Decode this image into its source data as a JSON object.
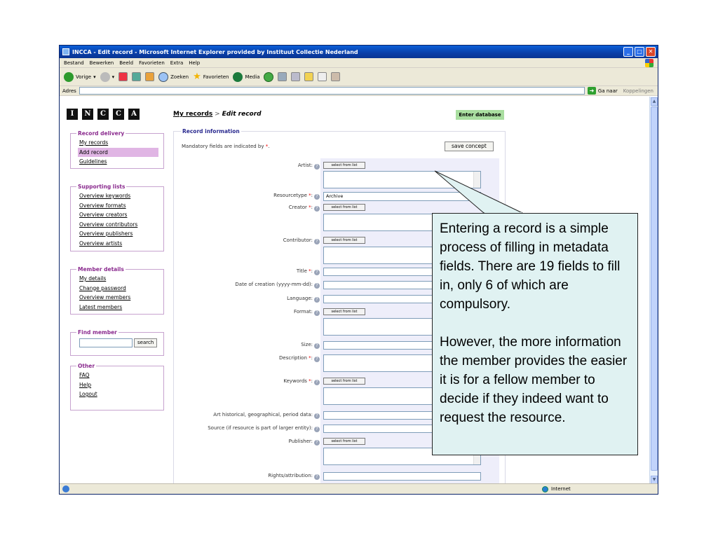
{
  "window": {
    "title": "INCCA - Edit record - Microsoft Internet Explorer provided by Instituut Collectie Nederland"
  },
  "menu": [
    "Bestand",
    "Bewerken",
    "Beeld",
    "Favorieten",
    "Extra",
    "Help"
  ],
  "toolbar": {
    "back": "Vorige",
    "search": "Zoeken",
    "favorites": "Favorieten",
    "media": "Media"
  },
  "address": {
    "label": "Adres",
    "go": "Ga naar",
    "links": "Koppelingen"
  },
  "logo_letters": [
    "I",
    "N",
    "C",
    "C",
    "A"
  ],
  "breadcrumb": {
    "link": "My records",
    "sep": ">",
    "current": "Edit record"
  },
  "enter_database": "Enter database",
  "sidebar": {
    "record_delivery": {
      "legend": "Record delivery",
      "items": [
        "My records",
        "Add record",
        "Guidelines"
      ]
    },
    "supporting_lists": {
      "legend": "Supporting lists",
      "items": [
        "Overview keywords",
        "Overview formats",
        "Overview creators",
        "Overview contributors",
        "Overview publishers",
        "Overview artists"
      ]
    },
    "member_details": {
      "legend": "Member details",
      "items": [
        "My details",
        "Change password",
        "Overview members",
        "Latest members"
      ]
    },
    "find_member": {
      "legend": "Find member",
      "button": "search"
    },
    "other": {
      "legend": "Other",
      "items": [
        "FAQ",
        "Help",
        "Logout"
      ]
    }
  },
  "record": {
    "legend": "Record information",
    "mandatory_note": "Mandatory fields are indicated by",
    "mandatory_mark": "*",
    "save_button": "save concept",
    "select_label": "select from list",
    "resourcetype_value": "Archive",
    "fields": {
      "artist": "Artist:",
      "resourcetype": "Resourcetype",
      "creator": "Creator",
      "contributor": "Contributor:",
      "title": "Title",
      "date_of_creation": "Date of creation (yyyy-mm-dd):",
      "language": "Language:",
      "format": "Format:",
      "size": "Size:",
      "description": "Description",
      "keywords": "Keywords",
      "art_historical": "Art historical, geographical, period data:",
      "source": "Source (if resource is part of larger entity):",
      "publisher": "Publisher:",
      "rights": "Rights/attribution:"
    }
  },
  "status": {
    "zone": "Internet"
  },
  "callout": {
    "para1": "Entering a record is a simple process of filling in metadata fields. There are 19 fields to fill in, only 6 of which are compulsory.",
    "para2": "However, the more information the member provides the easier it is for a fellow member to decide if they indeed want to request the resource."
  }
}
